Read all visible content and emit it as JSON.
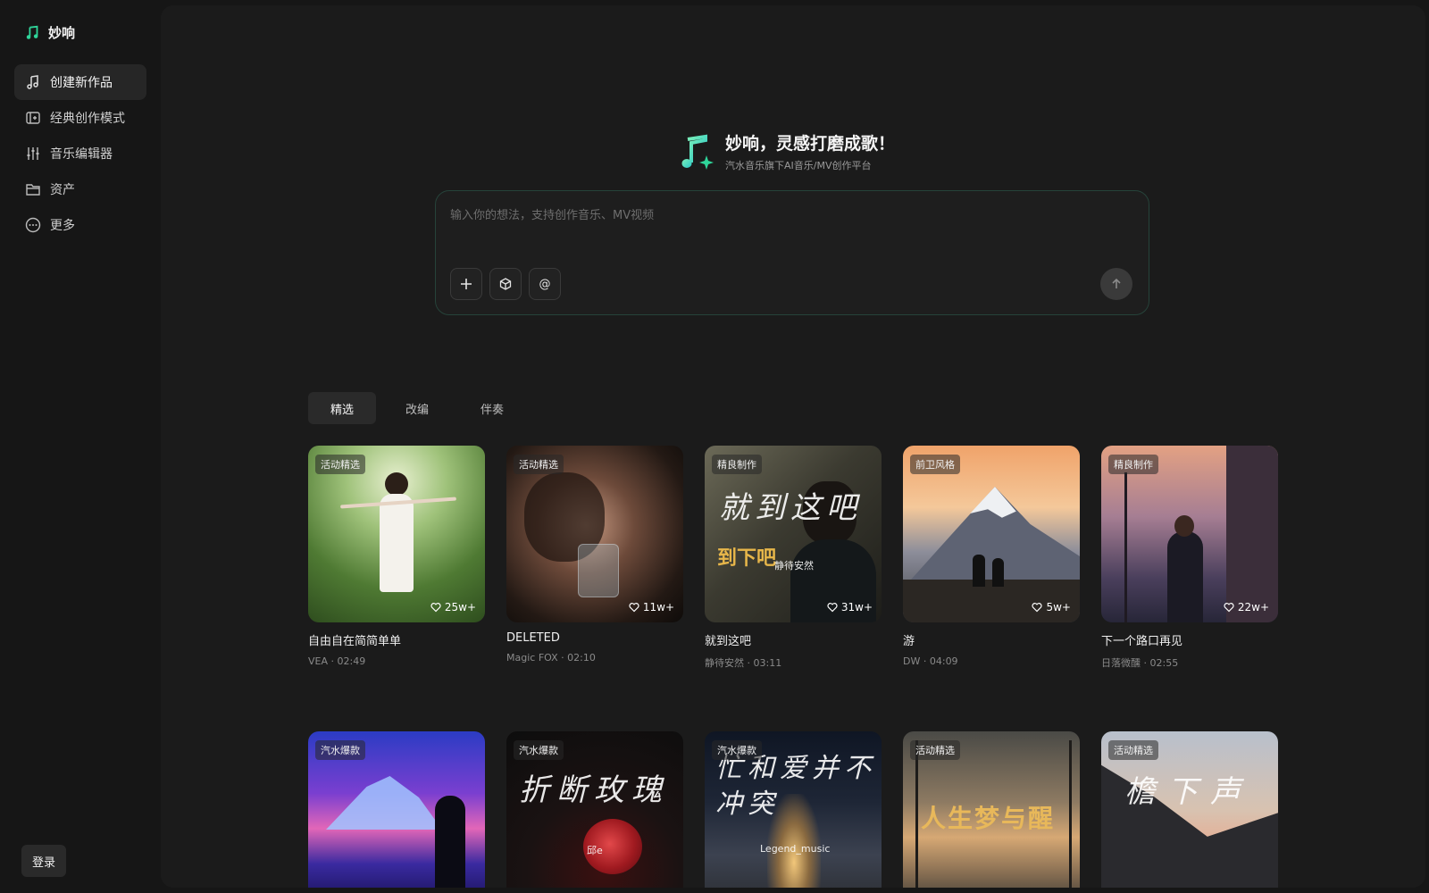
{
  "brand": {
    "name": "妙响"
  },
  "sidebar": {
    "items": [
      {
        "label": "创建新作品",
        "icon": "music-note-icon",
        "active": true
      },
      {
        "label": "经典创作模式",
        "icon": "template-icon",
        "active": false
      },
      {
        "label": "音乐编辑器",
        "icon": "sliders-icon",
        "active": false
      },
      {
        "label": "资产",
        "icon": "folder-icon",
        "active": false
      },
      {
        "label": "更多",
        "icon": "more-icon",
        "active": false
      }
    ],
    "login_label": "登录"
  },
  "hero": {
    "title": "妙响，灵感打磨成歌！",
    "subtitle": "汽水音乐旗下AI音乐/MV创作平台"
  },
  "prompt": {
    "placeholder": "输入你的想法，支持创作音乐、MV视频",
    "tools": [
      "plus-icon",
      "cube-icon",
      "at-icon"
    ],
    "send_icon": "arrow-up-icon"
  },
  "tabs": [
    {
      "label": "精选",
      "active": true
    },
    {
      "label": "改编",
      "active": false
    },
    {
      "label": "伴奏",
      "active": false
    }
  ],
  "cards": [
    {
      "badge": "活动精选",
      "likes": "25w+",
      "title": "自由自在简简单单",
      "artist": "VEA",
      "duration": "02:49"
    },
    {
      "badge": "活动精选",
      "likes": "11w+",
      "title": "DELETED",
      "artist": "Magic FOX",
      "duration": "02:10"
    },
    {
      "badge": "精良制作",
      "likes": "31w+",
      "title": "就到这吧",
      "artist": "静待安然",
      "duration": "03:11"
    },
    {
      "badge": "前卫风格",
      "likes": "5w+",
      "title": "游",
      "artist": "DW",
      "duration": "04:09"
    },
    {
      "badge": "精良制作",
      "likes": "22w+",
      "title": "下一个路口再见",
      "artist": "日落微醺",
      "duration": "02:55"
    },
    {
      "badge": "汽水爆款",
      "likes": "",
      "title": "",
      "artist": "",
      "duration": ""
    },
    {
      "badge": "汽水爆款",
      "likes": "",
      "title": "",
      "artist": "",
      "duration": ""
    },
    {
      "badge": "汽水爆款",
      "likes": "",
      "title": "",
      "artist": "",
      "duration": ""
    },
    {
      "badge": "活动精选",
      "likes": "",
      "title": "",
      "artist": "",
      "duration": ""
    },
    {
      "badge": "活动精选",
      "likes": "",
      "title": "",
      "artist": "",
      "duration": ""
    }
  ],
  "cover_texts": {
    "c3": "就到这吧",
    "c3b": "到下吧",
    "c3c": "静待安然",
    "c7": "折断玫瑰",
    "c7b": "邱e",
    "c8": "忙和爱并不冲突",
    "c8b": "Legend_music",
    "c9": "人生梦与醒",
    "c10": "檐下声"
  },
  "colors": {
    "accent": "#2fd59a",
    "background": "#161616",
    "panel": "#1b1b1b"
  }
}
